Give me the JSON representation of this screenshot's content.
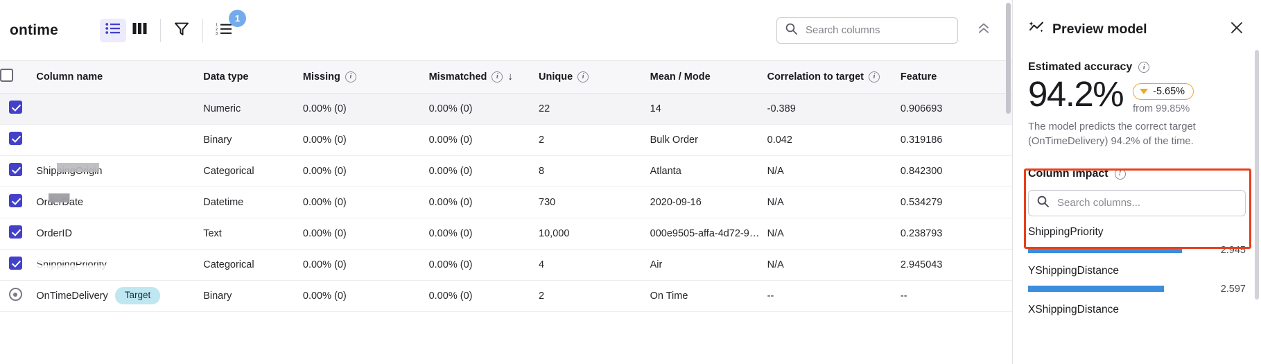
{
  "toolbar": {
    "dataset_title": "ontime",
    "view_list_icon": "list-view-icon",
    "view_columns_icon": "columns-view-icon",
    "filter_icon": "filter-icon",
    "order_icon": "ordered-list-icon",
    "filter_badge_count": "1",
    "search_placeholder": "Search columns",
    "search_value": "",
    "search_icon": "search-icon",
    "collapse_icon": "chevron-double-up-icon"
  },
  "table": {
    "headers": [
      {
        "label": "",
        "info": false
      },
      {
        "label": "Column name",
        "info": false
      },
      {
        "label": "Data type",
        "info": false
      },
      {
        "label": "Missing",
        "info": true
      },
      {
        "label": "Mismatched",
        "info": true,
        "sort": "↓"
      },
      {
        "label": "Unique",
        "info": true
      },
      {
        "label": "Mean / Mode",
        "info": false
      },
      {
        "label": "Correlation to target",
        "info": true
      },
      {
        "label": "Feature",
        "info": false
      }
    ],
    "rows": [
      {
        "checked": true,
        "is_target": false,
        "redact": "r1",
        "name": "",
        "badge": "",
        "dtype": "Numeric",
        "missing": "0.00% (0)",
        "mismatched": "0.00% (0)",
        "unique": "22",
        "mean_mode": "14",
        "correlation": "-0.389",
        "feature": "0.906693"
      },
      {
        "checked": true,
        "is_target": false,
        "redact": "r2",
        "name": "",
        "badge": "",
        "dtype": "Binary",
        "missing": "0.00% (0)",
        "mismatched": "0.00% (0)",
        "unique": "2",
        "mean_mode": "Bulk Order",
        "correlation": "0.042",
        "feature": "0.319186"
      },
      {
        "checked": true,
        "is_target": false,
        "redact": "r3",
        "name": "ShippingOrigin",
        "badge": "",
        "dtype": "Categorical",
        "missing": "0.00% (0)",
        "mismatched": "0.00% (0)",
        "unique": "8",
        "mean_mode": "Atlanta",
        "correlation": "N/A",
        "feature": "0.842300"
      },
      {
        "checked": true,
        "is_target": false,
        "redact": "r4",
        "name": "OrderDate",
        "badge": "",
        "dtype": "Datetime",
        "missing": "0.00% (0)",
        "mismatched": "0.00% (0)",
        "unique": "730",
        "mean_mode": "2020-09-16",
        "correlation": "N/A",
        "feature": "0.534279"
      },
      {
        "checked": true,
        "is_target": false,
        "redact": "r5",
        "name": "OrderID",
        "badge": "",
        "dtype": "Text",
        "missing": "0.00% (0)",
        "mismatched": "0.00% (0)",
        "unique": "10,000",
        "mean_mode": "000e9505-affa-4d72-9…",
        "correlation": "N/A",
        "feature": "0.238793"
      },
      {
        "checked": true,
        "is_target": false,
        "redact": "r6",
        "name": "ShippingPriority",
        "badge": "",
        "dtype": "Categorical",
        "missing": "0.00% (0)",
        "mismatched": "0.00% (0)",
        "unique": "4",
        "mean_mode": "Air",
        "correlation": "N/A",
        "feature": "2.945043"
      },
      {
        "checked": false,
        "is_target": true,
        "redact": "r7",
        "name": "OnTimeDelivery",
        "badge": "Target",
        "dtype": "Binary",
        "missing": "0.00% (0)",
        "mismatched": "0.00% (0)",
        "unique": "2",
        "mean_mode": "On Time",
        "correlation": "--",
        "feature": "--"
      }
    ]
  },
  "panel": {
    "title": "Preview model",
    "sparkle_icon": "sparkle-magic-icon",
    "close_icon": "close-x-icon",
    "accuracy": {
      "section_label": "Estimated accuracy",
      "value": "94.2%",
      "delta": "-5.65%",
      "delta_direction": "down",
      "from_label": "from 99.85%",
      "description": "The model predicts the correct target (OnTimeDelivery) 94.2% of the time."
    },
    "column_impact": {
      "section_label": "Column impact",
      "search_placeholder": "Search columns...",
      "search_value": "",
      "items": [
        {
          "name": "ShippingPriority",
          "value": "2.945",
          "pct": 86
        },
        {
          "name": "YShippingDistance",
          "value": "2.597",
          "pct": 76
        },
        {
          "name": "XShippingDistance",
          "value": "",
          "pct": 0
        }
      ]
    }
  },
  "colors": {
    "accent_purple": "#4340c9",
    "bar_blue": "#3b8ddd",
    "warning_orange": "#efa72c",
    "annotation_red": "#e8401c",
    "badge_blue": "#74abea",
    "target_badge": "#bfe7f1"
  }
}
